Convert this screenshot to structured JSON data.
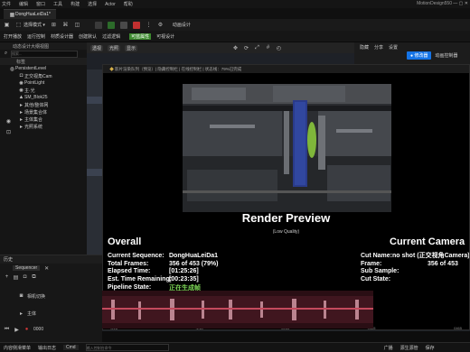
{
  "menubar": {
    "items": [
      "文件",
      "编辑",
      "窗口",
      "工具",
      "构建",
      "选择",
      "Actor",
      "帮助"
    ],
    "app_name": "MotionDesign550"
  },
  "tab": {
    "title": "DongHuaLeiDa1*"
  },
  "toolbar1": {
    "save_mode": "选择模式 ▾"
  },
  "toolbar2": {
    "items": [
      "打开播放",
      "运行控制",
      "材质设计器",
      "创建默认",
      "过滤逻辑"
    ],
    "highlight": "可蓝属性",
    "highlight2": "可视设计",
    "anim_label": "动画设计"
  },
  "outliner": {
    "title": "动态设计大纲视图",
    "search_placeholder": "搜索...",
    "header_col": "标签",
    "items": [
      "PersistentLevel",
      "正交视角Cam",
      "PointLight",
      "主·光",
      "SM_Blok25",
      "其他/整体网",
      "场景集合体",
      "主体集合",
      "光照系统"
    ]
  },
  "viewport": {
    "buttons": [
      "透视",
      "光照",
      "显示"
    ],
    "overlay_text": "显示"
  },
  "render_window": {
    "title": "影片渲染队列（预览）| 隐藏控制栏 | 在线控制栏 | 状态线：79%已完成",
    "preview_title": "Render Preview",
    "preview_sub": "(Low Quality)",
    "overall": {
      "heading": "Overall",
      "rows": [
        {
          "k": "Current Sequence:",
          "v": "DongHuaLeiDa1"
        },
        {
          "k": "Total Frames:",
          "v": "356 of 453 (79%)"
        },
        {
          "k": "Elapsed Time:",
          "v": "[01:25:26]"
        },
        {
          "k": "Est. Time Remaining:",
          "v": "[00:23:35]"
        },
        {
          "k": "Pipeline State:",
          "v": "正在生成帧"
        }
      ]
    },
    "current_camera": {
      "heading": "Current Camera",
      "rows": [
        {
          "k": "Cut Name:",
          "v": "no shot (正交视角Camera) ("
        },
        {
          "k": "Frame:",
          "v": "356 of 453"
        },
        {
          "k": "Sub Sample:",
          "v": ""
        },
        {
          "k": "Cut State:",
          "v": ""
        }
      ]
    },
    "bottom_nums": [
      "-218",
      "-218",
      "0265",
      "0465",
      "0465"
    ]
  },
  "right_panel": {
    "items": [
      "隐藏",
      "分享",
      "设置"
    ],
    "button": "● 修改器",
    "button2": "动画控制器"
  },
  "sequencer": {
    "tab": "Sequencer",
    "sub": "历史",
    "track_label": "相机切换",
    "track2": "主体",
    "frame": "0000"
  },
  "statusbar": {
    "left": [
      "内容侧滑菜单",
      "输出日志",
      "Cmd"
    ],
    "input_placeholder": "输入控制台命令",
    "right": [
      "广播",
      "源生源管",
      "保存"
    ]
  },
  "colors": {
    "accent": "#1473e6",
    "highlight_green": "#3c8a2e",
    "record_red": "#d03838"
  }
}
